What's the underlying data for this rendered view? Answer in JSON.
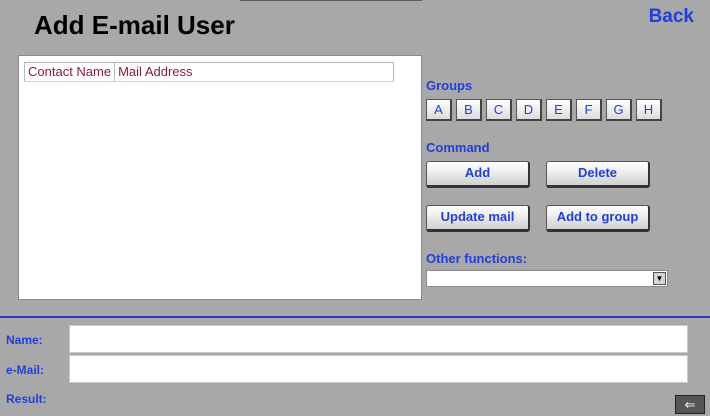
{
  "header": {
    "title": "Add E-mail User",
    "back_label": "Back"
  },
  "contact_list": {
    "columns": [
      "Contact Name",
      "Mail Address"
    ],
    "rows": []
  },
  "groups": {
    "label": "Groups",
    "buttons": [
      "A",
      "B",
      "C",
      "D",
      "E",
      "F",
      "G",
      "H"
    ]
  },
  "command": {
    "label": "Command",
    "add": "Add",
    "delete": "Delete",
    "update_mail": "Update mail",
    "add_to_group": "Add to group"
  },
  "other_functions": {
    "label": "Other functions:",
    "selected": ""
  },
  "form": {
    "name_label": "Name:",
    "name_value": "",
    "email_label": "e-Mail:",
    "email_value": "",
    "result_label": "Result:"
  },
  "colors": {
    "accent": "#1f3fe0",
    "header_text": "#8a1a4a",
    "background": "#a8a8a8"
  }
}
